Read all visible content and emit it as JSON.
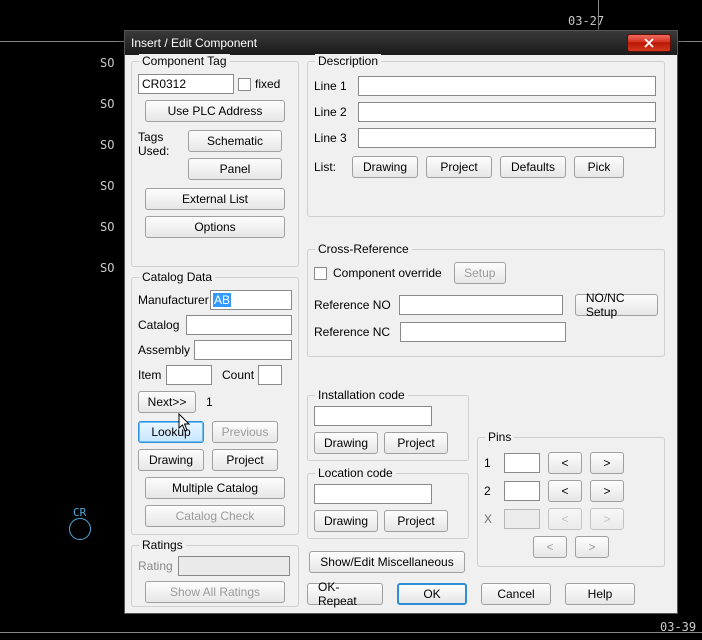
{
  "bg": {
    "date_top": "03-27",
    "date_bottom": "03-39",
    "cr_label": "CR",
    "wires": [
      "SO",
      "SO",
      "SO",
      "SO",
      "SO",
      "SO"
    ]
  },
  "window": {
    "title": "Insert / Edit Component",
    "close": "X"
  },
  "component_tag": {
    "legend": "Component Tag",
    "value": "CR0312",
    "fixed_label": "fixed",
    "use_plc": "Use PLC Address",
    "tags_used": "Tags Used:",
    "schematic": "Schematic",
    "panel": "Panel",
    "external_list": "External List",
    "options": "Options"
  },
  "catalog": {
    "legend": "Catalog Data",
    "manufacturer_label": "Manufacturer",
    "manufacturer_value": "AB",
    "catalog_label": "Catalog",
    "catalog_value": "",
    "assembly_label": "Assembly",
    "assembly_value": "",
    "item_label": "Item",
    "item_value": "",
    "count_label": "Count",
    "count_value": "",
    "next": "Next>>",
    "page": "1",
    "lookup": "Lookup",
    "previous": "Previous",
    "drawing": "Drawing",
    "project": "Project",
    "multiple_catalog": "Multiple Catalog",
    "catalog_check": "Catalog Check"
  },
  "ratings": {
    "legend": "Ratings",
    "rating_label": "Rating",
    "rating_value": "",
    "show_all": "Show All Ratings"
  },
  "description": {
    "legend": "Description",
    "line1_label": "Line 1",
    "line1_value": "",
    "line2_label": "Line 2",
    "line2_value": "",
    "line3_label": "Line 3",
    "line3_value": "",
    "list_label": "List:",
    "drawing": "Drawing",
    "project": "Project",
    "defaults": "Defaults",
    "pick": "Pick"
  },
  "xref": {
    "legend": "Cross-Reference",
    "comp_override_label": "Component override",
    "setup": "Setup",
    "ref_no_label": "Reference NO",
    "ref_no_value": "",
    "nonc_setup": "NO/NC Setup",
    "ref_nc_label": "Reference NC",
    "ref_nc_value": ""
  },
  "install": {
    "legend": "Installation code",
    "value": "",
    "drawing": "Drawing",
    "project": "Project"
  },
  "location": {
    "legend": "Location code",
    "value": "",
    "drawing": "Drawing",
    "project": "Project"
  },
  "pins": {
    "legend": "Pins",
    "row1_label": "1",
    "row1_value": "",
    "row2_label": "2",
    "row2_value": "",
    "rowx_label": "X",
    "rowx_value": "",
    "lt": "<",
    "gt": ">"
  },
  "footer": {
    "show_misc": "Show/Edit Miscellaneous",
    "ok_repeat": "OK-Repeat",
    "ok": "OK",
    "cancel": "Cancel",
    "help": "Help"
  }
}
